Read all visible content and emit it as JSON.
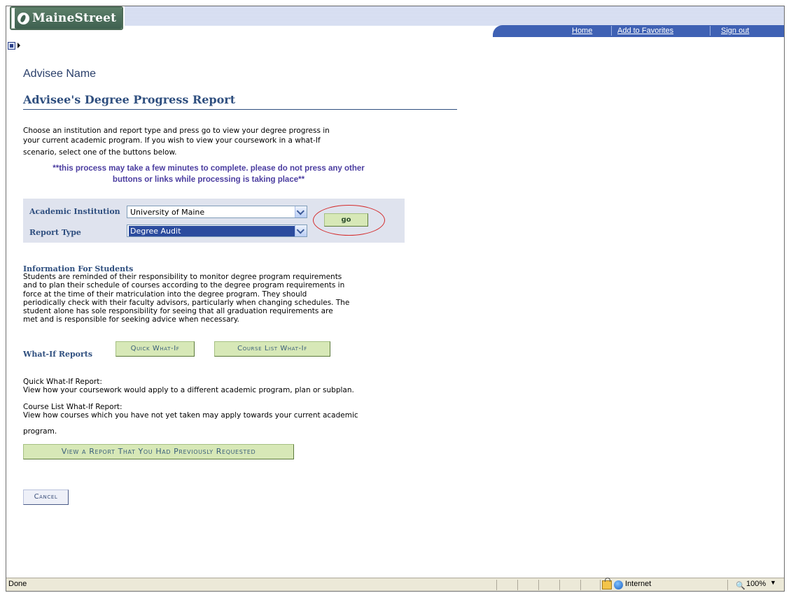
{
  "header": {
    "logo_text": "MaineStreet",
    "nav": {
      "home": "Home",
      "favorites": "Add to Favorites",
      "signout": "Sign out"
    }
  },
  "page": {
    "advisee_name": "Advisee Name",
    "title": "Advisee's Degree Progress Report",
    "intro_line1": "Choose an institution and report type and press go to view your degree progress in",
    "intro_line2": "your current academic program. If you wish to view your coursework in a what-If",
    "intro_line3": "scenario, select one of the buttons below.",
    "warning_line1": "**this process may take a few minutes to complete. please do not press any other",
    "warning_line2": "buttons or links while processing is taking place**"
  },
  "form": {
    "institution_label": "Academic Institution",
    "institution_value": "University of Maine",
    "report_type_label": "Report Type",
    "report_type_value": "Degree Audit",
    "go_label": "go"
  },
  "info": {
    "heading": "Information For Students",
    "lines": [
      "Students are reminded of their responsibility to monitor degree program requirements",
      "and to plan their schedule of courses according to the degree program requirements in",
      "force at the time of their matriculation into the degree program. They should",
      "periodically check with their faculty advisors, particularly when changing schedules. The",
      "student alone has sole responsibility for seeing that all graduation requirements are",
      "met and is responsible for seeking advice when necessary."
    ]
  },
  "whatif": {
    "label": "What-If Reports",
    "quick_button": "Quick What-If",
    "course_list_button": "Course List What-If",
    "quick_title": "Quick What-If Report:",
    "quick_desc": "View how your coursework would apply to a different academic program, plan or subplan.",
    "course_title": "Course List What-If Report:",
    "course_desc1": "View how courses which you have not yet taken may apply towards your current academic",
    "course_desc2": "program.",
    "previous_button": "View a Report That You Had Previously Requested",
    "cancel_button": "Cancel"
  },
  "status_bar": {
    "status": "Done",
    "zone": "Internet",
    "zoom": "100%"
  }
}
